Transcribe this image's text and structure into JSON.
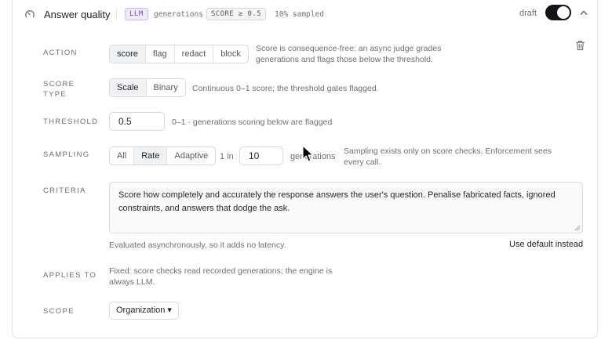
{
  "header": {
    "title": "Answer quality",
    "badge_engine": "LLM",
    "badge_target": "generations",
    "badge_threshold": "SCORE ≥ 0.5",
    "badge_sampled": "10% sampled",
    "status": "draft",
    "enabled": true
  },
  "action": {
    "label": "ACTION",
    "options": [
      "score",
      "flag",
      "redact",
      "block"
    ],
    "selected": "score",
    "help": "Score is consequence-free: an async judge grades generations and flags those below the threshold."
  },
  "score_type": {
    "label": "SCORE TYPE",
    "options": [
      "Scale",
      "Binary"
    ],
    "selected": "Scale",
    "help": "Continuous 0–1 score; the threshold gates flagged."
  },
  "threshold": {
    "label": "THRESHOLD",
    "value": "0.5",
    "help": "0–1 · generations scoring below are flagged"
  },
  "sampling": {
    "label": "SAMPLING",
    "options": [
      "All",
      "Rate",
      "Adaptive"
    ],
    "selected": "Rate",
    "prefix": "1 in",
    "value": "10",
    "suffix": "generations",
    "help": "Sampling exists only on score checks. Enforcement sees every call."
  },
  "criteria": {
    "label": "CRITERIA",
    "value": "Score how completely and accurately the response answers the user's question. Penalise fabricated facts, ignored constraints, and answers that dodge the ask.",
    "note": "Evaluated asynchronously, so it adds no latency.",
    "reset_label": "Use default instead"
  },
  "applies_to": {
    "label": "APPLIES TO",
    "text": "Fixed: score checks read recorded generations; the engine is always LLM."
  },
  "scope": {
    "label": "SCOPE",
    "value": "Organization ▾"
  },
  "icons": {
    "gauge": "gauge-icon",
    "collapse": "chevron-up-icon",
    "delete": "trash-icon",
    "cursor": "mouse-pointer-icon"
  }
}
